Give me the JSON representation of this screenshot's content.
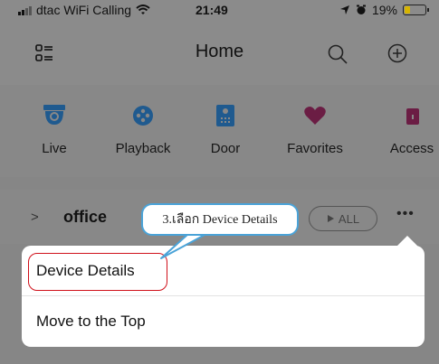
{
  "status_bar": {
    "carrier": "dtac WiFi Calling",
    "time": "21:49",
    "battery": "19%",
    "battery_level": 0.19
  },
  "header": {
    "title": "Home",
    "icons": [
      "menu-grid-icon",
      "search-icon",
      "add-icon"
    ]
  },
  "shortcuts": [
    {
      "label": "Live",
      "icon": "camera-icon"
    },
    {
      "label": "Playback",
      "icon": "playback-icon"
    },
    {
      "label": "Door",
      "icon": "door-icon"
    },
    {
      "label": "Favorites",
      "icon": "heart-icon"
    },
    {
      "label": "Access",
      "icon": "access-icon"
    }
  ],
  "group": {
    "name": "office",
    "all_label": "ALL"
  },
  "menu": {
    "items": [
      {
        "label": "Device Details"
      },
      {
        "label": "Move to the Top"
      }
    ]
  },
  "annotation": {
    "text": "3.เลือก Device Details"
  },
  "colors": {
    "accent_blue": "#1f5a8f",
    "highlight_red": "#d0101a",
    "callout_border": "#4aa3d8"
  }
}
